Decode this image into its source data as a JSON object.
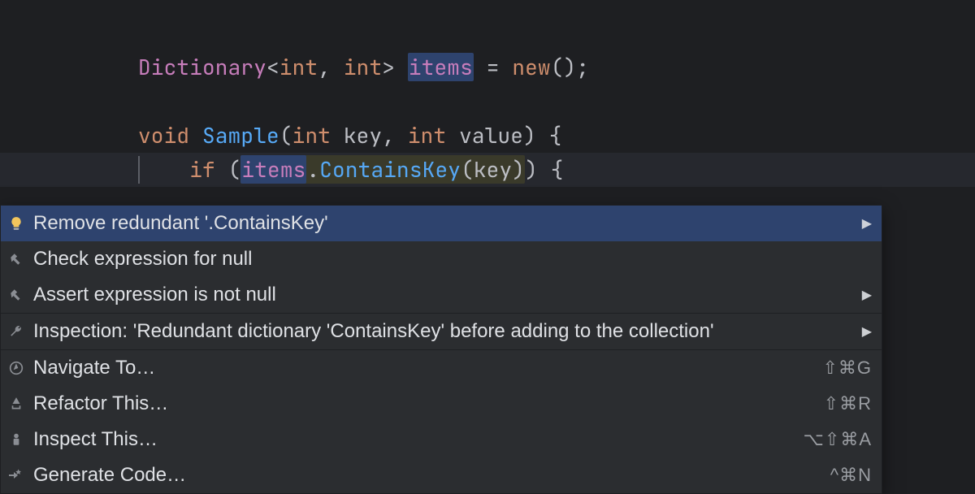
{
  "code": {
    "type": "Dictionary",
    "lt": "<",
    "int1": "int",
    "comma": ",",
    "sp": " ",
    "int2": "int",
    "gt": ">",
    "field": "items",
    "eq": " = ",
    "newkw": "new",
    "newp": "();",
    "void": "void",
    "func": "Sample",
    "lp": "(",
    "p1t": "int",
    "p1n": " key",
    "c2": ",",
    "p2t": "int",
    "p2n": " value",
    "rp": ")",
    "ob": " {",
    "if": "if",
    "lp2": " (",
    "items2": "items",
    "dot": ".",
    "contains": "ContainsKey",
    "lp3": "(",
    "key": "key",
    "rp3": ")",
    "rp2": ")",
    "ob2": " {"
  },
  "menu": {
    "items": [
      {
        "label": "Remove redundant '.ContainsKey'",
        "hasSubmenu": true,
        "shortcut": ""
      },
      {
        "label": "Check expression for null",
        "hasSubmenu": false,
        "shortcut": ""
      },
      {
        "label": "Assert expression is not null",
        "hasSubmenu": true,
        "shortcut": ""
      },
      {
        "label": "Inspection: 'Redundant dictionary 'ContainsKey' before adding to the collection'",
        "hasSubmenu": true,
        "shortcut": ""
      },
      {
        "label": "Navigate To…",
        "hasSubmenu": false,
        "shortcut": "⇧⌘G"
      },
      {
        "label": "Refactor This…",
        "hasSubmenu": false,
        "shortcut": "⇧⌘R"
      },
      {
        "label": "Inspect This…",
        "hasSubmenu": false,
        "shortcut": "⌥⇧⌘A"
      },
      {
        "label": "Generate Code…",
        "hasSubmenu": false,
        "shortcut": "^⌘N"
      }
    ]
  }
}
